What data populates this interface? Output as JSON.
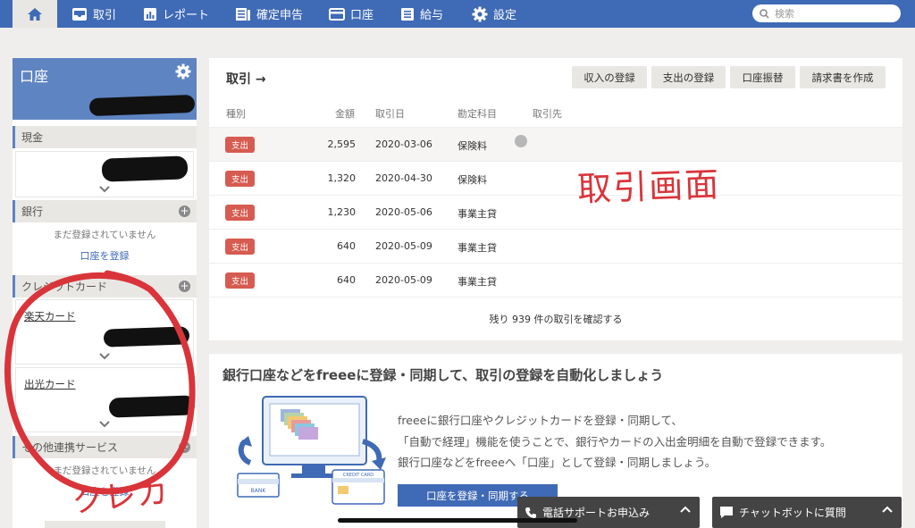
{
  "nav": {
    "items": [
      {
        "label": "取引",
        "icon": "inbox-icon"
      },
      {
        "label": "レポート",
        "icon": "chart-icon"
      },
      {
        "label": "確定申告",
        "icon": "document-icon"
      },
      {
        "label": "口座",
        "icon": "card-icon"
      },
      {
        "label": "給与",
        "icon": "list-icon"
      },
      {
        "label": "設定",
        "icon": "gear-icon"
      }
    ],
    "search_placeholder": "検索"
  },
  "sidebar": {
    "title": "口座",
    "sections": {
      "cash": "現金",
      "bank": "銀行",
      "credit": "クレジットカード",
      "other": "その他連携サービス"
    },
    "bank_empty": "まだ登録されていません",
    "bank_link": "口座を登録",
    "cards": [
      "楽天カード",
      "出光カード"
    ],
    "other_empty": "まだ登録されていません",
    "other_link": "口座を登録"
  },
  "main": {
    "title": "取引 →",
    "buttons": [
      "収入の登録",
      "支出の登録",
      "口座振替",
      "請求書を作成"
    ],
    "columns": [
      "種別",
      "金額",
      "取引日",
      "勘定科目",
      "取引先"
    ],
    "rows": [
      {
        "type": "支出",
        "amount": "2,595",
        "date": "2020-03-06",
        "account": "保険料"
      },
      {
        "type": "支出",
        "amount": "1,320",
        "date": "2020-04-30",
        "account": "保険料"
      },
      {
        "type": "支出",
        "amount": "1,230",
        "date": "2020-05-06",
        "account": "事業主貸"
      },
      {
        "type": "支出",
        "amount": "640",
        "date": "2020-05-09",
        "account": "事業主貸"
      },
      {
        "type": "支出",
        "amount": "640",
        "date": "2020-05-09",
        "account": "事業主貸"
      }
    ],
    "more": "残り 939 件の取引を確認する"
  },
  "promo": {
    "title": "銀行口座などをfreeeに登録・同期して、取引の登録を自動化しましょう",
    "lines": [
      "freeeに銀行口座やクレジットカードを登録・同期して、",
      "「自動で経理」機能を使うことで、銀行やカードの入出金明細を自動で登録できます。",
      "銀行口座などをfreeeへ「口座」として登録・同期しましょう。"
    ],
    "button": "口座を登録・同期する",
    "illus_bank": "BANK",
    "illus_card": "CREDIT CARD"
  },
  "widgets": {
    "phone": "電話サポートお申込み",
    "chat": "チャットボットに質問"
  },
  "annotations": {
    "screen": "取引画面",
    "crepa": "クレカ"
  },
  "colors": {
    "nav": "#3f6ab5",
    "badge": "#d65b50",
    "annotation": "#d9343a"
  }
}
